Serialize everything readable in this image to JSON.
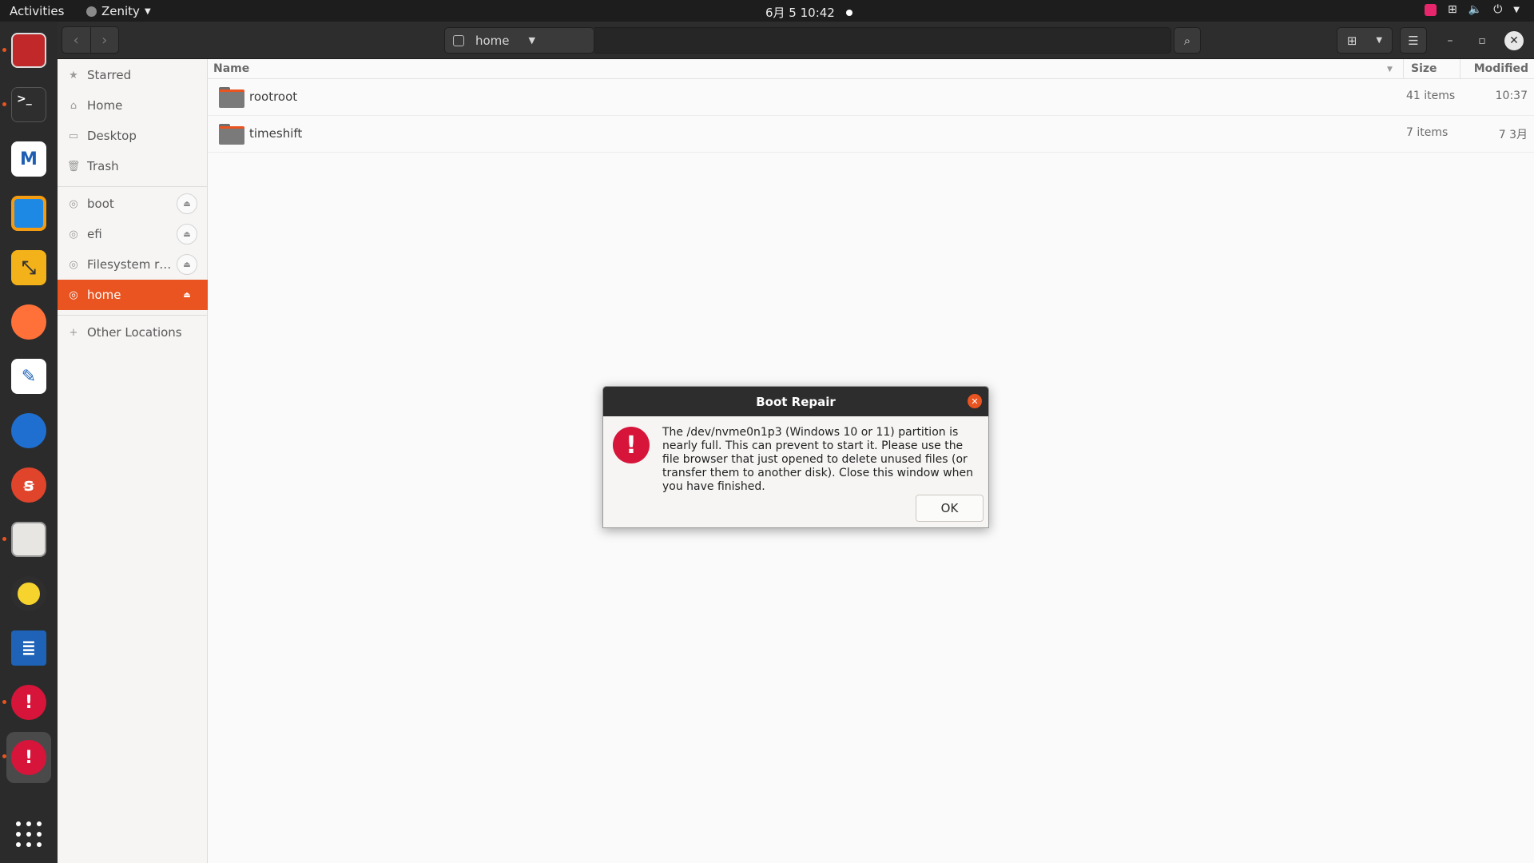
{
  "topbar": {
    "activities": "Activities",
    "app_name": "Zenity",
    "clock": "6月 5  10:42"
  },
  "dock": {
    "items": [
      {
        "name": "remote-desktop-icon",
        "color": "#c0282a"
      },
      {
        "name": "terminal-icon",
        "color": "#2e2e2e"
      },
      {
        "name": "mail-icon",
        "color": "#ffffff"
      },
      {
        "name": "virtual-machine-icon",
        "color": "#f39c12"
      },
      {
        "name": "network-arrows-icon",
        "color": "#f3b21a"
      },
      {
        "name": "firefox-icon",
        "color": "#ff7139"
      },
      {
        "name": "text-editor-icon",
        "color": "#ffffff"
      },
      {
        "name": "thunderbird-icon",
        "color": "#1f6fd1"
      },
      {
        "name": "app-red-icon",
        "color": "#e0452c"
      },
      {
        "name": "files-icon",
        "color": "#e8e6e3"
      },
      {
        "name": "rhythmbox-icon",
        "color": "#f6d32d"
      },
      {
        "name": "writer-icon",
        "color": "#1e63b8"
      },
      {
        "name": "alert-app-icon",
        "color": "#d7153a"
      },
      {
        "name": "alert-app-icon",
        "color": "#d7153a"
      }
    ]
  },
  "toolbar": {
    "path_label": "home"
  },
  "sidebar": {
    "items": [
      {
        "label": "Starred",
        "icon": "star-icon"
      },
      {
        "label": "Home",
        "icon": "home-icon"
      },
      {
        "label": "Desktop",
        "icon": "desktop-icon"
      },
      {
        "label": "Trash",
        "icon": "trash-icon"
      }
    ],
    "drives": [
      {
        "label": "boot"
      },
      {
        "label": "efi"
      },
      {
        "label": "Filesystem r…"
      },
      {
        "label": "home"
      }
    ],
    "other": "Other Locations"
  },
  "list": {
    "columns": {
      "name": "Name",
      "size": "Size",
      "modified": "Modified"
    },
    "rows": [
      {
        "name": "rootroot",
        "size": "41 items",
        "modified": "10:37"
      },
      {
        "name": "timeshift",
        "size": "7 items",
        "modified": "7 3月"
      }
    ]
  },
  "dialog": {
    "title": "Boot Repair",
    "message": "The /dev/nvme0n1p3 (Windows 10 or 11) partition is nearly full. This can prevent to start it. Please use the file browser that just opened to delete unused files (or transfer them to another disk). Close this window when you have finished.",
    "ok": "OK"
  }
}
